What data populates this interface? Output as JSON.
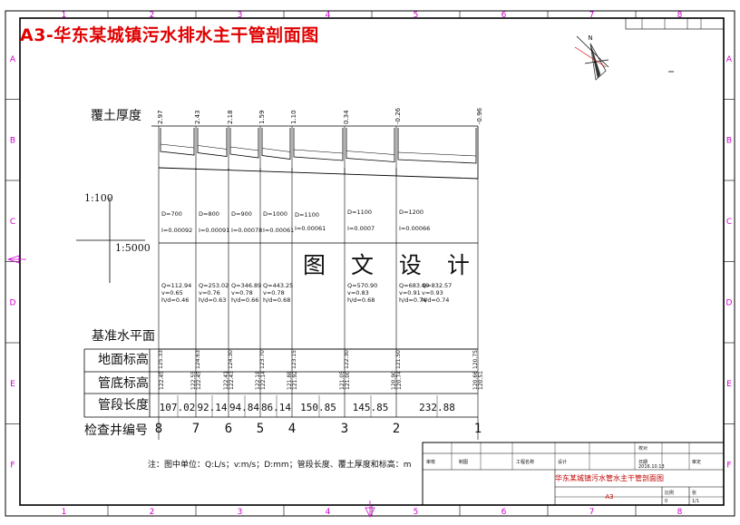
{
  "sheet": {
    "title": "A3-华东某城镇污水排水主干管剖面图",
    "watermark": "图 文 设 计",
    "note": "注：图中单位：Q:L/s；v:m/s；D:mm；管段长度、覆土厚度和标高：m",
    "frame_cols": [
      "1",
      "2",
      "3",
      "4",
      "5",
      "6",
      "7",
      "8"
    ],
    "frame_rows": [
      "A",
      "B",
      "C",
      "D",
      "E",
      "F"
    ]
  },
  "scales": {
    "vertical": "1:100",
    "horizontal": "1:5000"
  },
  "labels": {
    "cover": "覆土厚度",
    "datum": "基准水平面",
    "ground": "地面标高",
    "invert": "管底标高",
    "length": "管段长度",
    "manhole": "检查井编号"
  },
  "chart_data": {
    "type": "table",
    "manholes": [
      "8",
      "7",
      "6",
      "5",
      "4",
      "3",
      "2",
      "1"
    ],
    "cover_depth": [
      "2.97",
      "2.43",
      "2.18",
      "1.59",
      "1.10",
      "0.34",
      "-0.26",
      "-0.96"
    ],
    "ground_elevation": [
      "125.33",
      "124.63",
      "124.30",
      "123.70",
      "123.15",
      "122.30",
      "121.50",
      "120.75"
    ],
    "invert_upper": [
      "",
      "122.55",
      "122.41",
      "122.18",
      "121.88",
      "121.05",
      "120.90",
      "120.66"
    ],
    "invert_lower": [
      "122.45",
      "122.45",
      "122.43",
      "122.14",
      "121.92",
      "121.00",
      "120.74",
      "120.51"
    ],
    "segments": [
      {
        "from": "8",
        "to": "7",
        "D": "D=700",
        "slope": "I=0.00092",
        "Q": "Q=112.94",
        "v": "v=0.65",
        "hd": "h/d=0.46",
        "length": "107.02"
      },
      {
        "from": "7",
        "to": "6",
        "D": "D=800",
        "slope": "I=0.00091",
        "Q": "Q=253.02",
        "v": "v=0.76",
        "hd": "h/d=0.63",
        "length": "92.14"
      },
      {
        "from": "6",
        "to": "5",
        "D": "D=900",
        "slope": "I=0.00078",
        "Q": "Q=346.89",
        "v": "v=0.78",
        "hd": "h/d=0.66",
        "length": "94.84"
      },
      {
        "from": "5",
        "to": "4",
        "D": "D=1000",
        "slope": "I=0.00061",
        "Q": "Q=443.25",
        "v": "v=0.78",
        "hd": "h/d=0.68",
        "length": "86.14"
      },
      {
        "from": "4",
        "to": "3",
        "D": "D=1100",
        "slope": "I=0.00061",
        "Q": "",
        "v": "",
        "hd": "",
        "length": "150.85"
      },
      {
        "from": "3",
        "to": "2",
        "D": "D=1100",
        "slope": "I=0.0007",
        "Q": "Q=570.90",
        "v": "v=0.83",
        "hd": "h/d=0.68",
        "length": "145.85"
      },
      {
        "from": "2",
        "to": "1",
        "D": "D=1200",
        "slope": "I=0.00066",
        "Q": "Q=683.40",
        "v": "v=0.91",
        "hd": "h/d=0.74",
        "length": "232.88"
      },
      {
        "from": "",
        "to": "",
        "D": "",
        "slope": "",
        "Q": "Q=832.57",
        "v": "v=0.93",
        "hd": "h/d=0.74",
        "length": ""
      }
    ]
  },
  "title_block": {
    "drawing_name": "华东某城镇污水管水主干管剖面图",
    "sheet_size": "A3",
    "date_label": "日期",
    "date": "2016.10.13",
    "ratio_label": "比例",
    "sheet_label": "张",
    "sheet_no": "1/1",
    "revision": "0",
    "c1": "审核",
    "c2": "制图",
    "c3": "工程名称",
    "c4": "设计",
    "c5": "校对",
    "c6": "审定"
  },
  "colors": {
    "title": "#e00000",
    "title_block_text": "#c00000",
    "frame": "#000000",
    "frame_marks": "#cc00cc"
  }
}
